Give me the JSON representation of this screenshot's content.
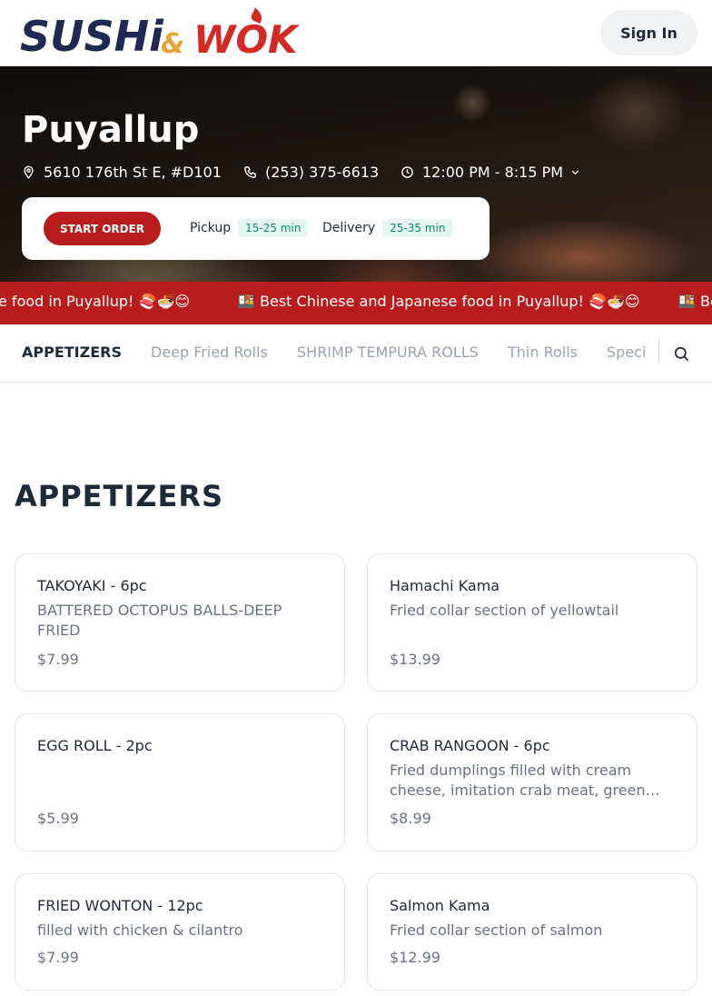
{
  "header": {
    "logo_text_1": "SUSHi",
    "logo_amp": "&",
    "logo_text_2": "WOK",
    "sign_in_label": "Sign In"
  },
  "hero": {
    "title": "Puyallup",
    "address": "5610 176th St E, #D101",
    "phone": "(253) 375-6613",
    "hours": "12:00 PM - 8:15 PM",
    "start_order_label": "START ORDER",
    "pickup_label": "Pickup",
    "pickup_time": "15-25 min",
    "delivery_label": "Delivery",
    "delivery_time": "25-35 min"
  },
  "marquee": {
    "text_1": "e food in Puyallup! 🍣🍜😊",
    "text_2": "🍱 Best Chinese and Japanese food in Puyallup! 🍣🍜😊",
    "text_3": "🍱 Bes"
  },
  "categories": [
    {
      "label": "APPETIZERS",
      "active": true
    },
    {
      "label": "Deep Fried Rolls",
      "active": false
    },
    {
      "label": "SHRIMP TEMPURA ROLLS",
      "active": false
    },
    {
      "label": "Thin Rolls",
      "active": false
    },
    {
      "label": "Speci",
      "active": false
    }
  ],
  "section": {
    "title": "APPETIZERS"
  },
  "items": [
    {
      "name": "TAKOYAKI - 6pc",
      "desc": "BATTERED OCTOPUS BALLS-DEEP FRIED",
      "price": "$7.99"
    },
    {
      "name": "Hamachi Kama",
      "desc": "Fried collar section of yellowtail",
      "price": "$13.99"
    },
    {
      "name": "EGG ROLL - 2pc",
      "desc": "",
      "price": "$5.99"
    },
    {
      "name": "CRAB RANGOON - 6pc",
      "desc": "Fried dumplings filled with cream cheese, imitation crab meat, green…",
      "price": "$8.99"
    },
    {
      "name": "FRIED WONTON - 12pc",
      "desc": "filled with chicken & cilantro",
      "price": "$7.99"
    },
    {
      "name": "Salmon Kama",
      "desc": "Fried collar section of salmon",
      "price": "$12.99"
    }
  ],
  "colors": {
    "brand_red": "#b91c1c",
    "logo_navy": "#1e2a52",
    "badge_green": "#0f8a70"
  }
}
